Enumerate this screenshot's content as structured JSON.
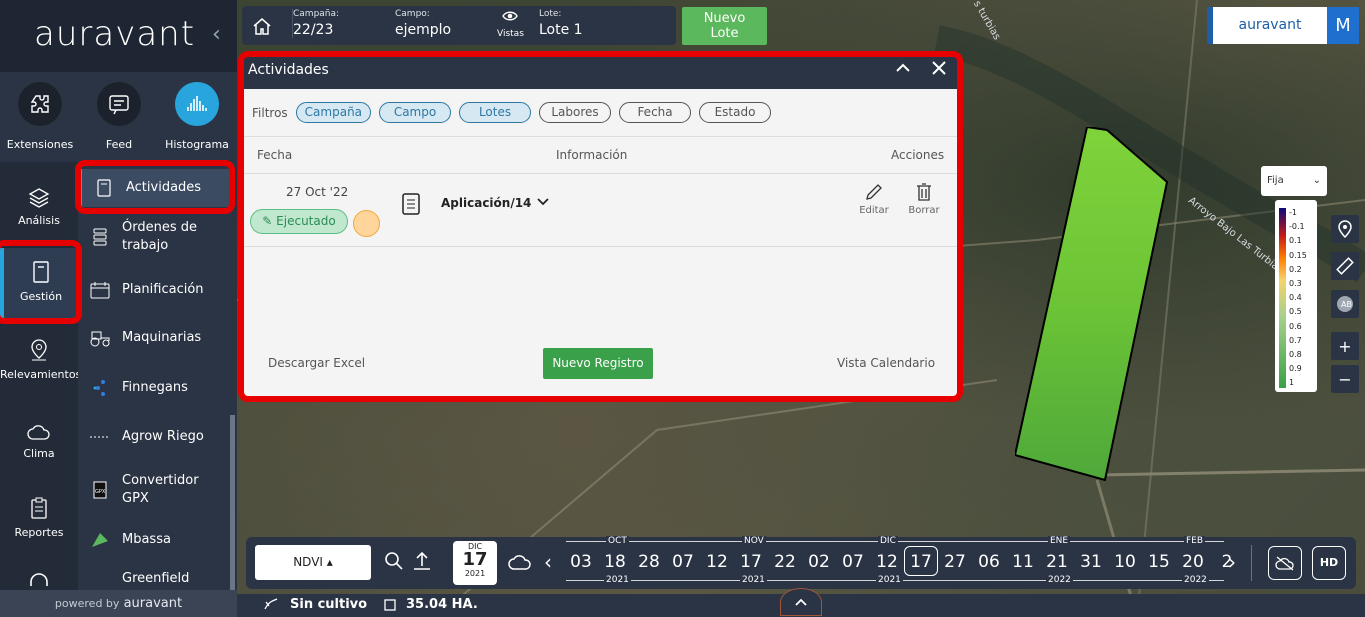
{
  "sidebar": {
    "brand": "auravant",
    "collapse_glyph": "‹",
    "top_items": [
      {
        "label": "Extensiones",
        "icon": "puzzle-icon"
      },
      {
        "label": "Feed",
        "icon": "feed-icon"
      },
      {
        "label": "Histograma",
        "icon": "histogram-icon"
      }
    ],
    "nav": [
      {
        "label": "Análisis",
        "icon": "layers-icon"
      },
      {
        "label": "Gestión",
        "icon": "notebook-icon",
        "active": true
      },
      {
        "label": "Relevamientos",
        "icon": "map-pin-icon"
      },
      {
        "label": "Clima",
        "icon": "cloud-icon"
      },
      {
        "label": "Reportes",
        "icon": "clipboard-icon"
      }
    ],
    "sub": [
      {
        "label": "Actividades",
        "icon": "notebook-icon",
        "active": true
      },
      {
        "label": "Órdenes de trabajo",
        "icon": "stack-icon"
      },
      {
        "label": "Planificación",
        "icon": "calendar-icon"
      },
      {
        "label": "Maquinarias",
        "icon": "tractor-icon"
      },
      {
        "label": "Finnegans",
        "icon": "finnegans-icon"
      },
      {
        "label": "Agrow Riego",
        "icon": "dots-icon"
      },
      {
        "label": "Convertidor GPX",
        "icon": "gpx-icon"
      },
      {
        "label": "Mbassa",
        "icon": "mbassa-icon"
      },
      {
        "label": "Greenfield",
        "icon": "greenfield-icon"
      }
    ],
    "powered": "powered by",
    "powered_brand": "auravant"
  },
  "topbar": {
    "campana_label": "Campaña:",
    "campana_value": "22/23",
    "campo_label": "Campo:",
    "campo_value": "ejemplo",
    "vistas_label": "Vistas",
    "lote_label": "Lote:",
    "lote_value": "Lote 1",
    "new_lote_line1": "Nuevo",
    "new_lote_line2": "Lote"
  },
  "account": {
    "brand": "auravant",
    "initial": "M"
  },
  "panel": {
    "title": "Actividades",
    "filters_label": "Filtros",
    "filters": [
      {
        "label": "Campaña",
        "active": true
      },
      {
        "label": "Campo",
        "active": true
      },
      {
        "label": "Lotes",
        "active": true
      },
      {
        "label": "Labores",
        "active": false
      },
      {
        "label": "Fecha",
        "active": false
      },
      {
        "label": "Estado",
        "active": false
      }
    ],
    "col_fecha": "Fecha",
    "col_info": "Información",
    "col_acciones": "Acciones",
    "row": {
      "date": "27 Oct '22",
      "status": "Ejecutado",
      "activity": "Aplicación/14",
      "edit": "Editar",
      "delete": "Borrar"
    },
    "download": "Descargar Excel",
    "new_record": "Nuevo Registro",
    "calendar_view": "Vista Calendario"
  },
  "map": {
    "river_label_1": "Arroyo Bajo Las Turbias",
    "river_label_2": "s turbias",
    "legend_select": "Fija",
    "legend_ticks": [
      "-1",
      "-0.1",
      "0.1",
      "0.15",
      "0.2",
      "0.3",
      "0.4",
      "0.5",
      "0.6",
      "0.7",
      "0.8",
      "0.9",
      "1"
    ],
    "zoom_in": "+",
    "zoom_out": "−"
  },
  "bottom": {
    "index": "NDVI",
    "cal_month": "DIC",
    "cal_day": "17",
    "cal_year": "2021",
    "timeline": [
      {
        "day": "03"
      },
      {
        "day": "18",
        "month": "OCT",
        "year": "2021"
      },
      {
        "day": "28"
      },
      {
        "day": "07"
      },
      {
        "day": "12"
      },
      {
        "day": "17",
        "month": "NOV",
        "year": "2021"
      },
      {
        "day": "22"
      },
      {
        "day": "02"
      },
      {
        "day": "07"
      },
      {
        "day": "12",
        "month": "DIC",
        "year": "2021"
      },
      {
        "day": "17",
        "selected": true
      },
      {
        "day": "27"
      },
      {
        "day": "06"
      },
      {
        "day": "11"
      },
      {
        "day": "21",
        "month": "ENE",
        "year": "2022"
      },
      {
        "day": "31"
      },
      {
        "day": "10"
      },
      {
        "day": "15"
      },
      {
        "day": "20",
        "month": "FEB",
        "year": "2022"
      },
      {
        "day": "2"
      }
    ],
    "hd": "HD"
  },
  "status": {
    "crop": "Sin cultivo",
    "area": "35.04 HA."
  }
}
